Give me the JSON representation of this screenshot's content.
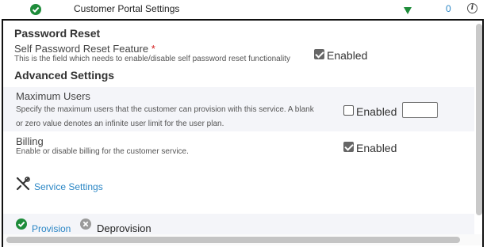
{
  "top_row": {
    "title": "Customer Portal Settings",
    "count": "0",
    "info_glyph": "i",
    "icons": {
      "status": "check-circle-icon",
      "expand": "triangle-down-icon",
      "info": "info-icon"
    },
    "colors": {
      "check": "#1e8c3a",
      "count": "#2a86c5"
    }
  },
  "password_reset": {
    "heading": "Password Reset",
    "feature_label": "Self Password Reset Feature",
    "required_marker": "*",
    "description": "This is the field which needs to enable/disable self password reset functionality",
    "checkbox_label": "Enabled",
    "checked": true
  },
  "advanced": {
    "heading": "Advanced Settings",
    "max_users": {
      "label": "Maximum Users",
      "description_line1": "Specify the maximum users that the customer can provision with this service. A blank",
      "description_line2": "or zero value denotes an infinite user limit for the user plan.",
      "checkbox_label": "Enabled",
      "checked": false,
      "value": ""
    },
    "billing": {
      "label": "Billing",
      "description": "Enable or disable billing for the customer service.",
      "checkbox_label": "Enabled",
      "checked": true
    }
  },
  "service_settings": {
    "label": "Service Settings",
    "icon": "wrench-icon"
  },
  "actions": {
    "provision_label": "Provision",
    "deprovision_label": "Deprovision",
    "icons": {
      "provision": "check-circle-icon",
      "deprovision": "x-circle-icon"
    }
  }
}
